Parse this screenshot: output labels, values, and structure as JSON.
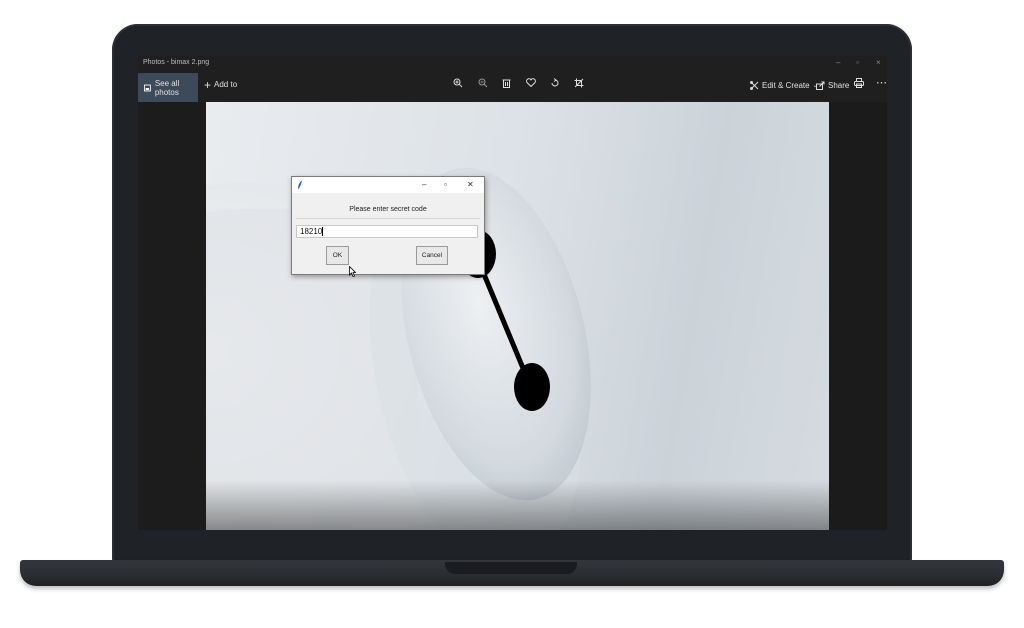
{
  "window": {
    "title": "Photos - bimax 2.png"
  },
  "toolbar": {
    "see_all_label": "See all photos",
    "add_to_label": "Add to",
    "edit_create_label": "Edit & Create",
    "share_label": "Share",
    "icons": [
      "zoom-in-icon",
      "zoom-out-icon",
      "delete-icon",
      "favorite-icon",
      "rotate-icon",
      "crop-icon"
    ]
  },
  "dialog": {
    "prompt": "Please enter secret code",
    "input_value": "18210",
    "ok_label": "OK",
    "cancel_label": "Cancel"
  }
}
